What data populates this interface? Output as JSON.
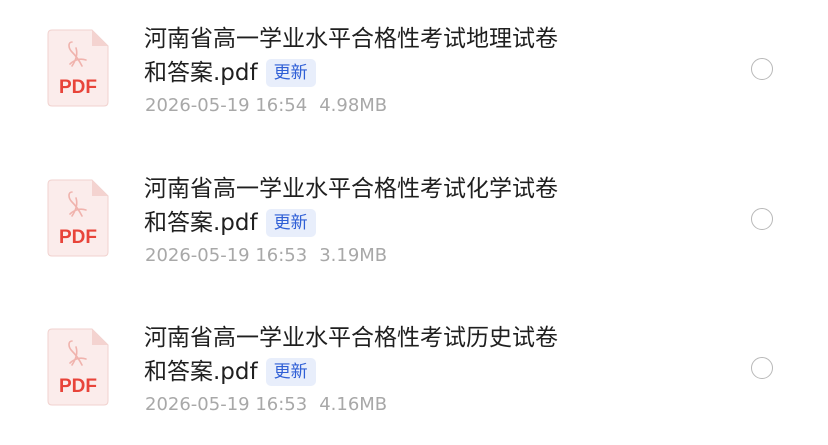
{
  "files": [
    {
      "name_line1": "河南省高一学业水平合格性考试地理试卷",
      "name_line2": "和答案.pdf",
      "badge": "更新",
      "date": "2026-05-19 16:54",
      "size": "4.98MB",
      "icon_label": "PDF",
      "icon": "pdf-file-icon"
    },
    {
      "name_line1": "河南省高一学业水平合格性考试化学试卷",
      "name_line2": "和答案.pdf",
      "badge": "更新",
      "date": "2026-05-19 16:53",
      "size": "3.19MB",
      "icon_label": "PDF",
      "icon": "pdf-file-icon"
    },
    {
      "name_line1": "河南省高一学业水平合格性考试历史试卷",
      "name_line2": "和答案.pdf",
      "badge": "更新",
      "date": "2026-05-19 16:53",
      "size": "4.16MB",
      "icon_label": "PDF",
      "icon": "pdf-file-icon"
    }
  ],
  "colors": {
    "pdf_red": "#e8443a",
    "pdf_bg": "#fbeceb",
    "badge_text": "#2f5fd6",
    "badge_bg": "#e8eefb",
    "meta_text": "#a8a8a8"
  }
}
